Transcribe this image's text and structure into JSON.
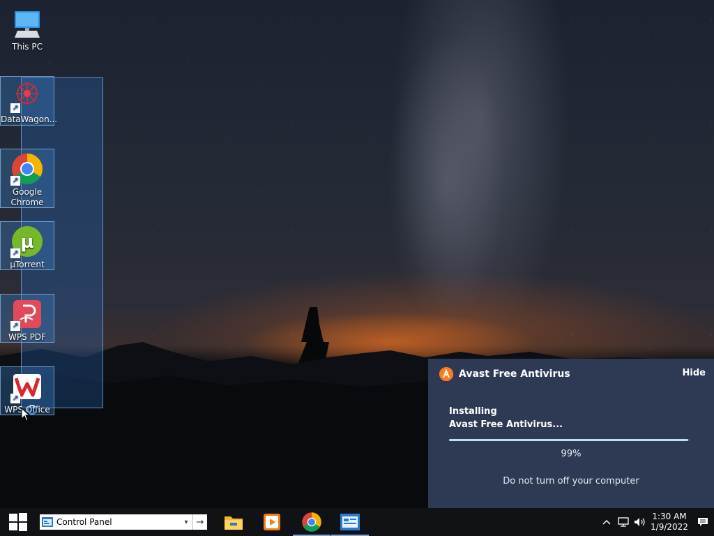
{
  "desktop": {
    "icons": [
      {
        "label": "This PC",
        "icon": "computer-icon"
      },
      {
        "label": "DataWagon...",
        "icon": "datawagon-icon"
      },
      {
        "label": "Google Chrome",
        "icon": "chrome-icon"
      },
      {
        "label": "µTorrent",
        "icon": "utorrent-icon"
      },
      {
        "label": "WPS PDF",
        "icon": "wps-pdf-icon"
      },
      {
        "label": "WPS Office",
        "icon": "wps-office-icon"
      }
    ]
  },
  "avast": {
    "title": "Avast Free Antivirus",
    "hide_label": "Hide",
    "status_line1": "Installing",
    "status_line2": "Avast Free Antivirus...",
    "progress_text": "99%",
    "progress_value": 0.99,
    "footer": "Do not turn off your computer",
    "colors": {
      "panel": "#2e3a54",
      "accent": "#ff7a1a",
      "progress": "#b8e4f0"
    }
  },
  "taskbar": {
    "start_icon": "windows-logo-icon",
    "address_bar": {
      "value": "Control Panel",
      "icon": "control-panel-icon"
    },
    "apps": [
      {
        "name": "file-explorer-icon",
        "active": false
      },
      {
        "name": "media-player-icon",
        "active": false
      },
      {
        "name": "chrome-icon",
        "active": true
      },
      {
        "name": "control-panel-icon",
        "active": true
      }
    ],
    "tray": {
      "icons": [
        "chevron-up-icon",
        "network-icon",
        "volume-icon",
        "notification-icon"
      ],
      "time": "1:30 AM",
      "date": "1/9/2022"
    }
  }
}
